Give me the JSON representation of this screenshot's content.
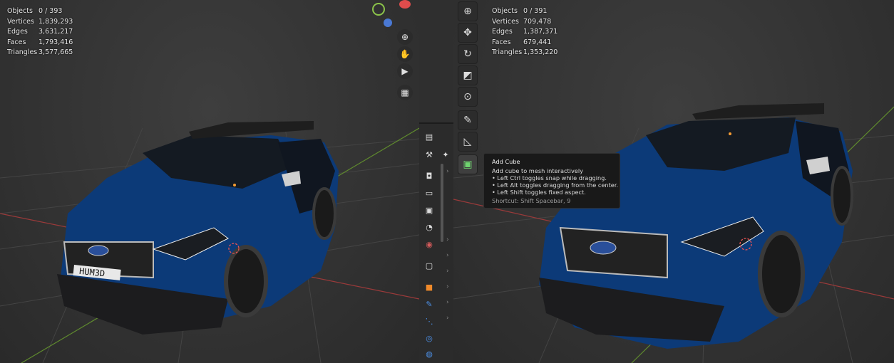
{
  "left_viewport": {
    "stats": [
      {
        "label": "Objects",
        "value": "0 / 393"
      },
      {
        "label": "Vertices",
        "value": "1,839,293"
      },
      {
        "label": "Edges",
        "value": "3,631,217"
      },
      {
        "label": "Faces",
        "value": "1,793,416"
      },
      {
        "label": "Triangles",
        "value": "3,577,665"
      }
    ],
    "plate_text": "HUM3D",
    "nav_icons": [
      "zoom-icon",
      "hand-pan-icon",
      "camera-icon",
      "grid-icon"
    ]
  },
  "right_viewport": {
    "stats": [
      {
        "label": "Objects",
        "value": "0 / 391"
      },
      {
        "label": "Vertices",
        "value": "709,478"
      },
      {
        "label": "Edges",
        "value": "1,387,371"
      },
      {
        "label": "Faces",
        "value": "679,441"
      },
      {
        "label": "Triangles",
        "value": "1,353,220"
      }
    ]
  },
  "toolbar": {
    "tools": [
      "cursor-tool",
      "move-tool",
      "rotate-tool",
      "scale-tool",
      "transform-tool",
      "annotate-tool",
      "measure-tool",
      "add-cube-tool"
    ],
    "active": "add-cube-tool"
  },
  "tooltip": {
    "title": "Add Cube",
    "description": "Add cube to mesh interactively",
    "lines": [
      "• Left Ctrl toggles snap while dragging.",
      "• Left Alt toggles dragging from the center.",
      "• Left Shift toggles fixed aspect."
    ],
    "shortcut": "Shortcut: Shift Spacebar, 9"
  },
  "properties_tabs": [
    "tool",
    "render",
    "output",
    "view-layer",
    "scene",
    "world",
    "collection",
    "object",
    "modifiers",
    "particles",
    "physics",
    "constraints"
  ],
  "colors": {
    "car_blue": "#0c3a78",
    "axis_red": "#9a3a3a",
    "axis_green": "#5f8a2e",
    "viewport_bg": "#363636"
  }
}
